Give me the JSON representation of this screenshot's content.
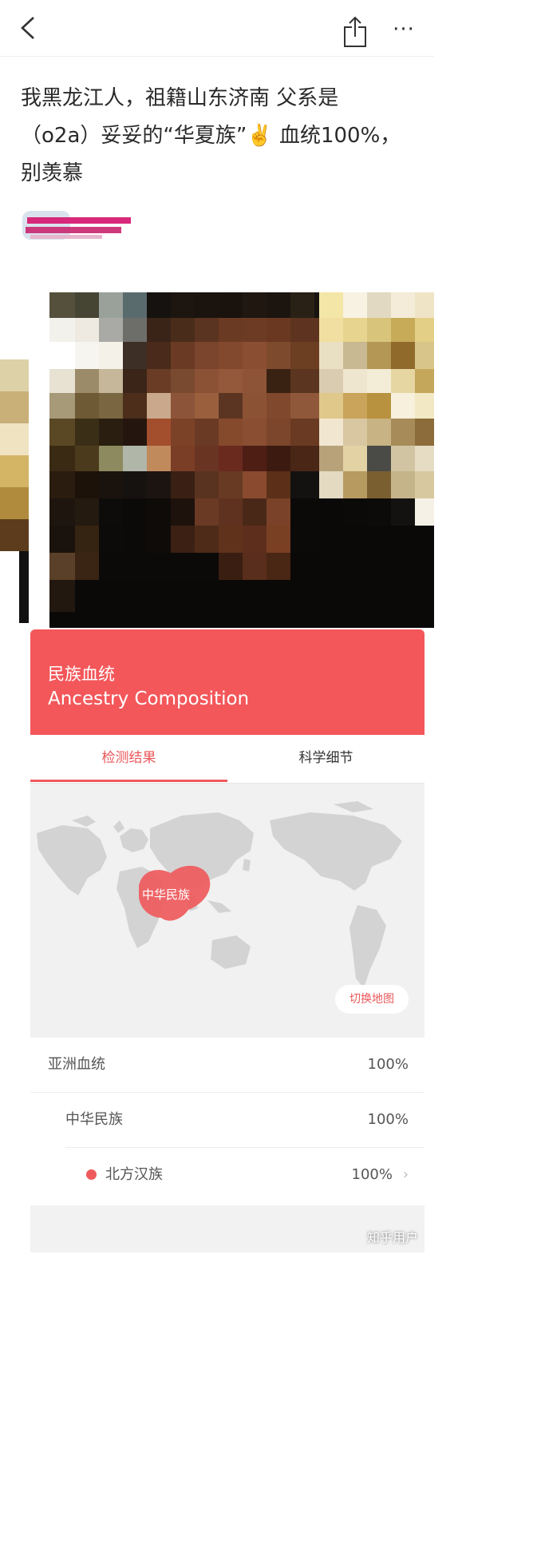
{
  "post": {
    "line1": "我黑龙江人，祖籍山东济南 父系是",
    "line2a": "（o2a）妥妥的“华夏族”",
    "emoji": "✌️",
    "line2b": " 血统100%，",
    "line3": "别羡慕"
  },
  "card": {
    "title_cn": "民族血统",
    "title_en": "Ancestry Composition",
    "tabs": [
      "检测结果",
      "科学细节"
    ],
    "map_label": "中华民族",
    "switch_map": "切换地图",
    "rows": [
      {
        "label": "亚洲血统",
        "value": "100%"
      },
      {
        "label": "中华民族",
        "value": "100%"
      },
      {
        "label": "北方汉族",
        "value": "100%"
      }
    ]
  },
  "watermark": "知乎用户",
  "icons": {
    "back": "back-arrow-icon",
    "share": "share-icon",
    "more": "more-icon",
    "chevron": "chevron-right-icon"
  },
  "colors": {
    "accent": "#f3575a"
  }
}
